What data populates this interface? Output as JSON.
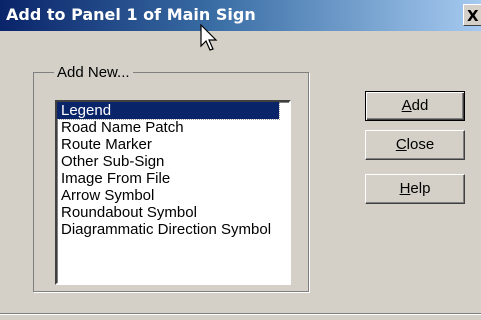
{
  "window": {
    "title": "Add to Panel 1 of Main Sign",
    "close_glyph": "X"
  },
  "group": {
    "label": "Add New..."
  },
  "list": {
    "items": [
      "Legend",
      "Road Name Patch",
      "Route Marker",
      "Other Sub-Sign",
      "Image From File",
      "Arrow Symbol",
      "Roundabout Symbol",
      "Diagrammatic Direction Symbol"
    ],
    "selected": "Legend"
  },
  "buttons": {
    "add": {
      "mnemonic": "A",
      "rest": "dd"
    },
    "close": {
      "mnemonic": "C",
      "rest": "lose"
    },
    "help": {
      "mnemonic": "H",
      "rest": "elp"
    }
  },
  "colors": {
    "title_bar_start": "#0a246a",
    "title_bar_end": "#a6caf0",
    "selection": "#0a246a",
    "dialog_face": "#d4d0c8"
  }
}
